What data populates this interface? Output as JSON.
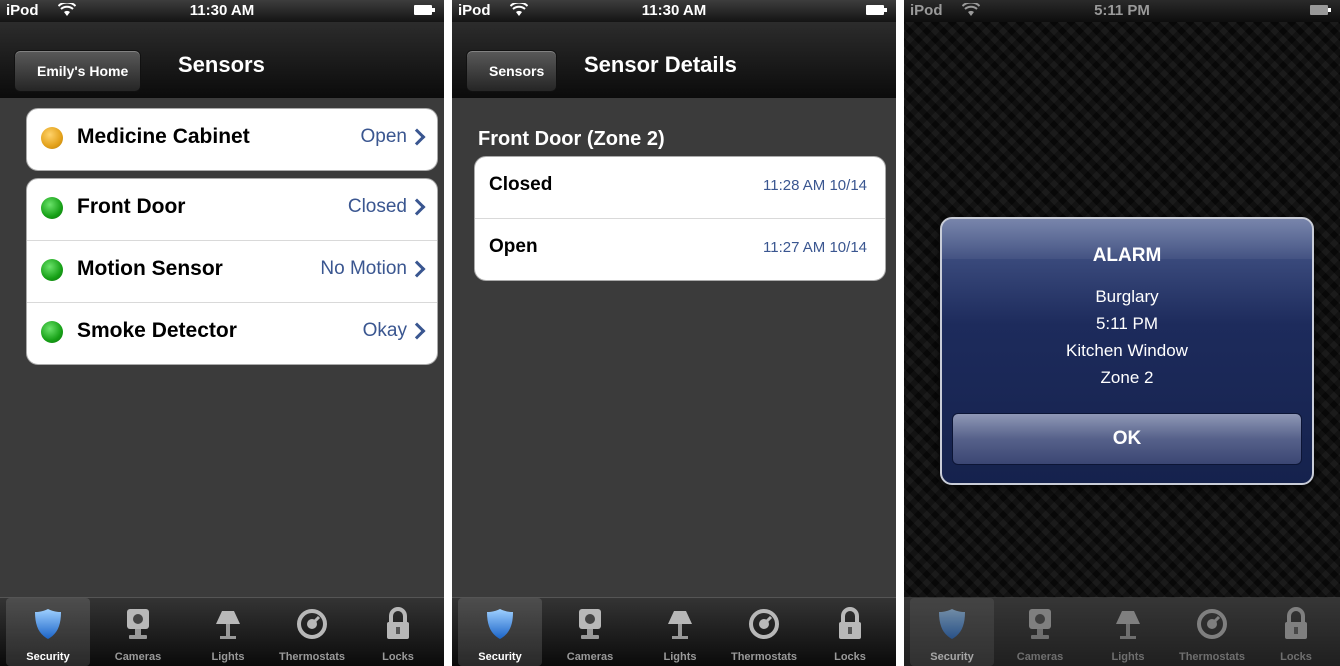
{
  "screens": [
    {
      "status": {
        "device": "iPod",
        "time": "11:30 AM"
      },
      "nav": {
        "back": "Emily's Home",
        "title": "Sensors"
      },
      "groups": [
        [
          {
            "label": "Medicine Cabinet",
            "value": "Open",
            "status_color": "#e3a11a"
          }
        ],
        [
          {
            "label": "Front Door",
            "value": "Closed",
            "status_color": "#17a117"
          },
          {
            "label": "Motion Sensor",
            "value": "No Motion",
            "status_color": "#17a117"
          },
          {
            "label": "Smoke Detector",
            "value": "Okay",
            "status_color": "#17a117"
          }
        ]
      ]
    },
    {
      "status": {
        "device": "iPod",
        "time": "11:30 AM"
      },
      "nav": {
        "back": "Sensors",
        "title": "Sensor Details"
      },
      "section_title": "Front Door (Zone 2)",
      "history": [
        {
          "state": "Closed",
          "time": "11:28 AM 10/14"
        },
        {
          "state": "Open",
          "time": "11:27 AM 10/14"
        }
      ]
    },
    {
      "status": {
        "device": "iPod",
        "time": "5:11 PM"
      },
      "alert": {
        "title": "ALARM",
        "lines": [
          "Burglary",
          "5:11 PM",
          "Kitchen Window",
          "Zone 2"
        ],
        "button": "OK",
        "color": "#1d2b5c"
      }
    }
  ],
  "tabs": [
    {
      "label": "Security",
      "icon": "shield-icon"
    },
    {
      "label": "Cameras",
      "icon": "camera-icon"
    },
    {
      "label": "Lights",
      "icon": "lamp-icon"
    },
    {
      "label": "Thermostats",
      "icon": "thermostat-icon"
    },
    {
      "label": "Locks",
      "icon": "lock-icon"
    }
  ],
  "active_tab": "Security",
  "colors": {
    "accent_blue": "#3a5690",
    "ok_green": "#17a117",
    "warn_orange": "#e3a11a"
  }
}
